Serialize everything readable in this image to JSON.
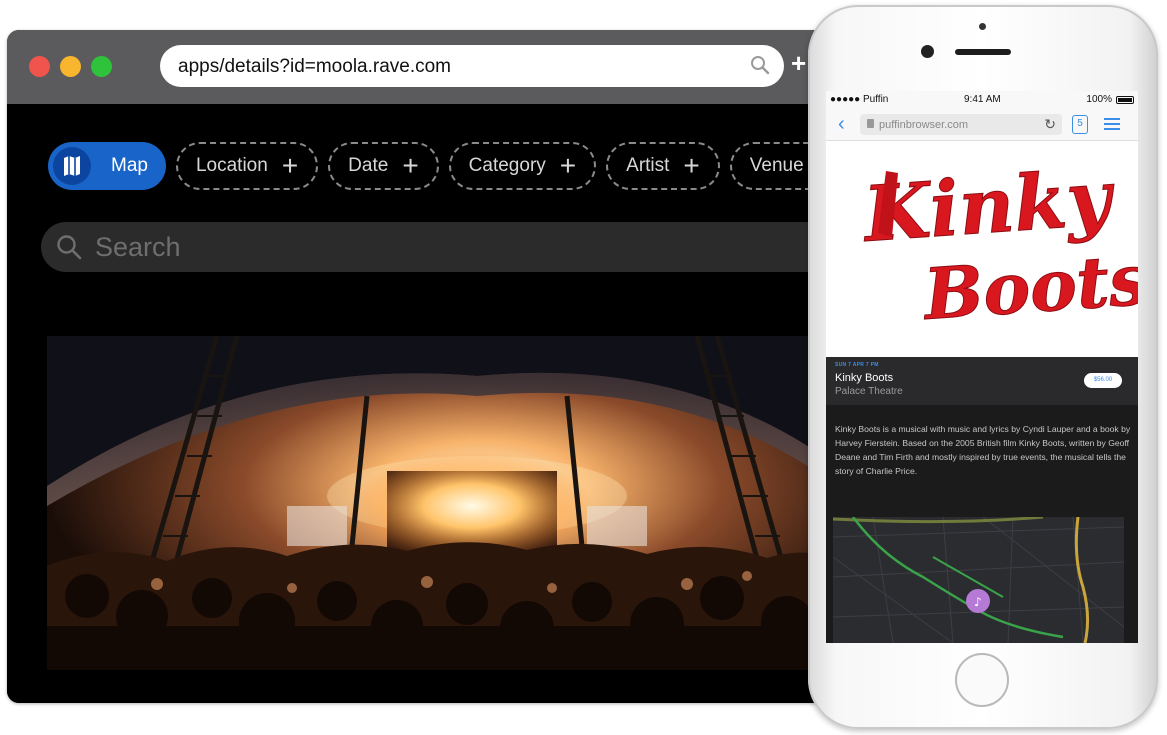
{
  "browser": {
    "url": "apps/details?id=moola.rave.com",
    "new_tab_label": "+",
    "filters": [
      {
        "label": "Map",
        "active": true
      },
      {
        "label": "Location"
      },
      {
        "label": "Date"
      },
      {
        "label": "Category"
      },
      {
        "label": "Artist"
      },
      {
        "label": "Venue"
      }
    ],
    "search_placeholder": "Search",
    "hero_image": "concert-crowd-under-stage-tent"
  },
  "phone": {
    "status": {
      "carrier": "●●●●● Puffin",
      "time": "9:41 AM",
      "battery": "100%"
    },
    "address_host": "puffinbrowser.com",
    "tabs_count": "5",
    "poster_logo": "Kinky Boots",
    "event": {
      "date_label": "SUN 7 APR 7 PM",
      "title": "Kinky Boots",
      "venue": "Palace Theatre",
      "price": "$56.00",
      "description": "Kinky Boots is a musical with music and lyrics by Cyndi Lauper and a book by Harvey Fierstein. Based on the 2005 British film Kinky Boots, written by Geoff Deane and Tim Firth and mostly inspired by true events, the musical tells the story of Charlie Price."
    }
  },
  "colors": {
    "accent_blue": "#1964c8",
    "phone_link_blue": "#3a8ee6",
    "logo_red": "#d8171f",
    "map_pin_purple": "#b57ad6"
  }
}
